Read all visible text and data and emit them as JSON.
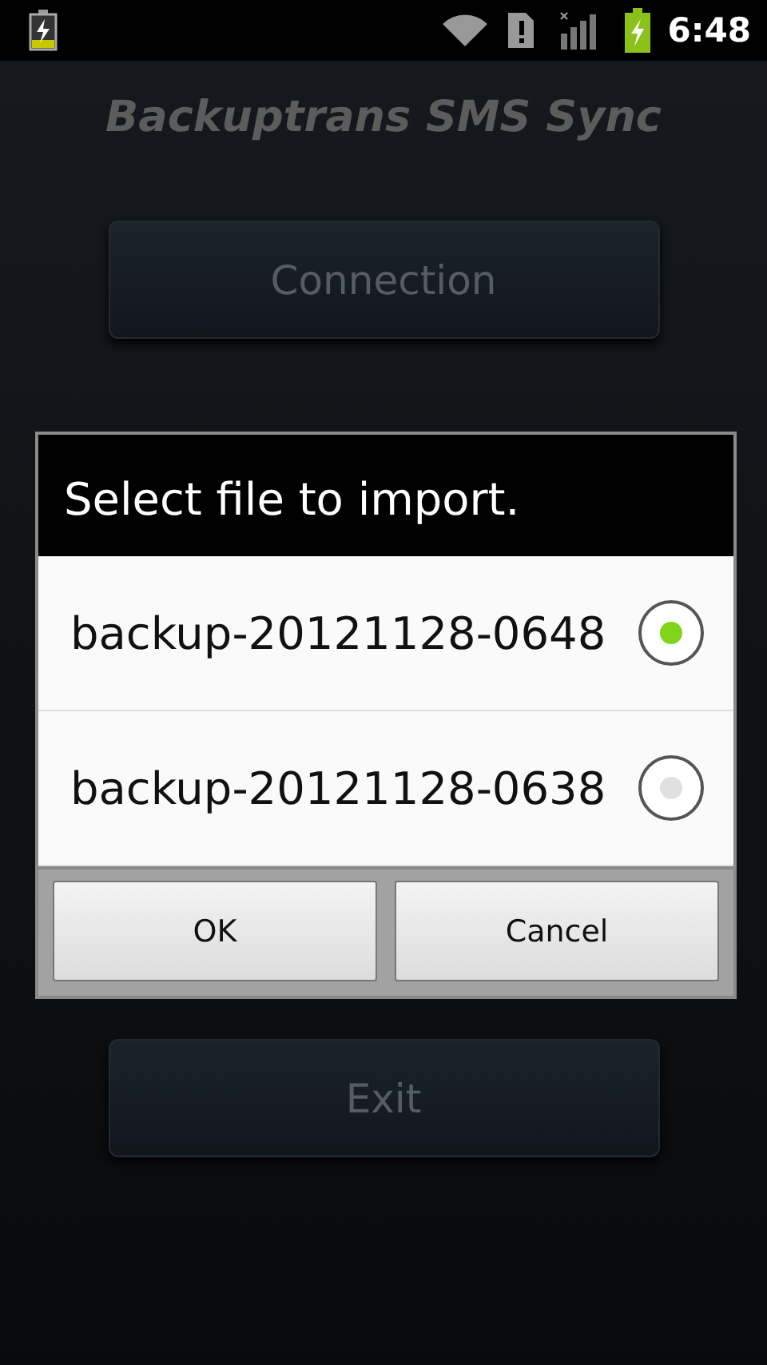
{
  "status_bar": {
    "time": "6:48"
  },
  "app_title": "Backuptrans SMS Sync",
  "menu_buttons": [
    {
      "label": "Connection"
    },
    {
      "label": "Exit"
    }
  ],
  "dialog": {
    "title": "Select file to import.",
    "options": [
      {
        "label": "backup-20121128-0648",
        "selected": true
      },
      {
        "label": "backup-20121128-0638",
        "selected": false
      }
    ],
    "buttons": [
      "OK",
      "Cancel"
    ]
  }
}
